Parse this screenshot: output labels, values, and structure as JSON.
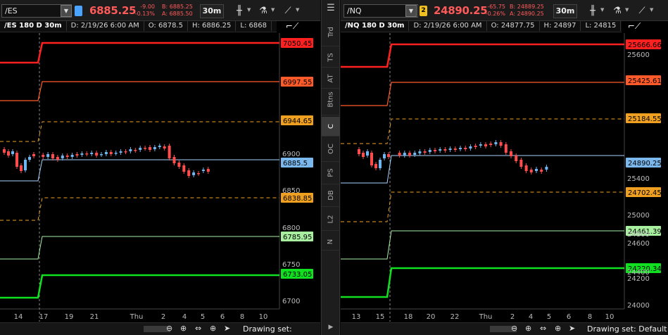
{
  "left": {
    "symbol": "/ES",
    "link_number": "",
    "link_color": "#4aa3ff",
    "last": "6885.25",
    "change": "-9.00",
    "change_pct": "-0.13%",
    "bid": "B: 6885.25",
    "ask": "A: 6885.50",
    "timeframe": "30m",
    "study": "/ES 180 D 30m",
    "date": "D: 2/19/26 6:00 AM",
    "open": "O: 6878.5",
    "high": "H: 6886.25",
    "low": "L: 6868",
    "drawing_set": "Drawing set: Default",
    "yticks": [
      "6900",
      "6850",
      "6800",
      "6750",
      "6700"
    ],
    "xticks": [
      "14",
      "17",
      "19",
      "21",
      "Thu",
      "2",
      "4",
      "5",
      "6",
      "8",
      "10"
    ],
    "levels": [
      {
        "label": "7050.45",
        "color": "#ff2020",
        "bg": "#ff2020",
        "fg": "#000"
      },
      {
        "label": "6997.55",
        "color": "#ff5a2a",
        "bg": "#ff5a2a",
        "fg": "#000"
      },
      {
        "label": "6944.65",
        "color": "#f0a020",
        "bg": "#f0a020",
        "fg": "#000"
      },
      {
        "label": "6885.5",
        "color": "#a8d4ff",
        "bg": "#7ab8ee",
        "fg": "#000"
      },
      {
        "label": "6838.85",
        "color": "#f0a020",
        "bg": "#f0a020",
        "fg": "#000"
      },
      {
        "label": "6785.95",
        "color": "#a8f0a0",
        "bg": "#a8f0a0",
        "fg": "#000"
      },
      {
        "label": "6733.05",
        "color": "#10e020",
        "bg": "#10e020",
        "fg": "#000"
      }
    ]
  },
  "right": {
    "symbol": "/NQ",
    "link_number": "2",
    "link_color": "#f0c020",
    "last": "24890.25",
    "change": "-65.75",
    "change_pct": "-0.26%",
    "bid": "B: 24889.25",
    "ask": "A: 24890.25",
    "timeframe": "30m",
    "study": "/NQ 180 D 30m",
    "date": "D: 2/19/26 6:00 AM",
    "open": "O: 24877.75",
    "high": "H: 24897",
    "low": "L: 24815",
    "drawing_set": "Drawing set: Default",
    "yticks": [
      "25600",
      "25400",
      "25000",
      "24800",
      "24600",
      "24400",
      "24200",
      "24000"
    ],
    "xticks": [
      "13",
      "15",
      "18",
      "20",
      "22",
      "Thu",
      "2",
      "4",
      "5",
      "6",
      "8",
      "10"
    ],
    "levels": [
      {
        "label": "25666.66",
        "color": "#ff2020",
        "bg": "#ff2020",
        "fg": "#000"
      },
      {
        "label": "25425.61",
        "color": "#ff5a2a",
        "bg": "#ff5a2a",
        "fg": "#000"
      },
      {
        "label": "25184.55",
        "color": "#f0a020",
        "bg": "#f0a020",
        "fg": "#000"
      },
      {
        "label": "24890.25",
        "color": "#a8d4ff",
        "bg": "#7ab8ee",
        "fg": "#000"
      },
      {
        "label": "24702.45",
        "color": "#f0a020",
        "bg": "#f0a020",
        "fg": "#000"
      },
      {
        "label": "24461.39",
        "color": "#a8f0a0",
        "bg": "#a8f0a0",
        "fg": "#000"
      },
      {
        "label": "24220.34",
        "color": "#10e020",
        "bg": "#10e020",
        "fg": "#000"
      }
    ]
  },
  "sidebar": {
    "tabs": [
      "Trd",
      "TS",
      "AT",
      "Btns",
      "C",
      "OC",
      "PS",
      "DB",
      "L2",
      "N"
    ],
    "active": "C"
  },
  "icons": {
    "menu": "hamburger-icon",
    "candle": "candlestick-icon",
    "studies": "flask-icon",
    "drawing": "drawing-tools-icon",
    "zoom_out": "zoom-out-icon",
    "zoom_in": "zoom-in-icon",
    "pan": "pan-icon",
    "crosshair": "crosshair-icon",
    "pointer": "pointer-icon"
  }
}
